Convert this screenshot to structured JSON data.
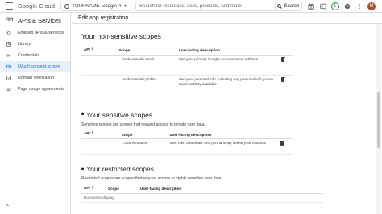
{
  "topbar": {
    "brand": "Google Cloud",
    "project": "YOURNAME-Google-4-Ta...",
    "search_placeholder": "Search for resources, docs, products, and more",
    "search_label": "Search",
    "notifications_count": "1",
    "avatar_letter": "M"
  },
  "sidebar": {
    "title": "APIs & Services",
    "api_tag": "RPI",
    "items": [
      {
        "label": "Enabled APIs & services",
        "icon": "diamond-icon"
      },
      {
        "label": "Library",
        "icon": "library-icon"
      },
      {
        "label": "Credentials",
        "icon": "key-icon"
      },
      {
        "label": "OAuth consent screen",
        "icon": "consent-icon",
        "active": true
      },
      {
        "label": "Domain verification",
        "icon": "checkbox-icon"
      },
      {
        "label": "Page usage agreements",
        "icon": "settings-list-icon"
      }
    ],
    "collapse_label": "<|"
  },
  "main": {
    "header": "Edit app registration",
    "non_sensitive": {
      "title": "Your non-sensitive scopes",
      "headers": {
        "api": "API",
        "scope": "Scope",
        "desc": "User-facing description"
      },
      "rows": [
        {
          "api": "",
          "scope": ".../auth/userinfo.email",
          "desc": "See your primary Google Account email address"
        },
        {
          "api": "",
          "scope": ".../auth/userinfo.profile",
          "desc": "See your personal info, including any personal info you've made publicly available"
        }
      ]
    },
    "sensitive": {
      "title": "Your sensitive scopes",
      "description": "Sensitive scopes are scopes that request access to private user data.",
      "headers": {
        "api": "API",
        "scope": "Scope",
        "desc": "User-facing description"
      },
      "rows": [
        {
          "api": "",
          "scope": ".../auth/contacts",
          "desc": "See, edit, download, and permanently delete your contacts"
        }
      ]
    },
    "restricted": {
      "title": "Your restricted scopes",
      "description": "Restricted scopes are scopes that request access to highly sensitive user data.",
      "headers": {
        "api": "API",
        "scope": "Scope",
        "desc": "User-facing description"
      },
      "empty_text": "No rows to display"
    }
  },
  "colors": {
    "accent": "#1967d2",
    "active_bg": "#e8f0fe",
    "border": "#dadce0",
    "text": "#202124"
  }
}
